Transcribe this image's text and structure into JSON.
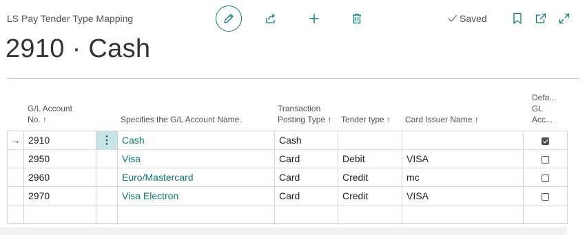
{
  "header": {
    "breadcrumb_title": "LS Pay Tender Type Mapping",
    "saved_status": "Saved",
    "page_title": "2910 · Cash"
  },
  "toolbar": {
    "edit_icon": "pencil-icon",
    "share_icon": "share-icon",
    "new_icon": "plus-icon",
    "delete_icon": "trash-icon"
  },
  "right_icons": [
    "bookmark-icon",
    "open-in-new-window-icon",
    "expand-icon"
  ],
  "table": {
    "columns": {
      "gl_account_no": "G/L Account No. ↑",
      "gl_account_name": "Specifies the G/L Account Name.",
      "transaction_posting_type": "Transaction Posting Type ↑",
      "tender_type": "Tender type ↑",
      "card_issuer_name": "Card Issuer Name ↑",
      "default_gl_account": "Defa... GL Acc..."
    },
    "rows": [
      {
        "gl_account_no": "2910",
        "gl_account_name": "Cash",
        "transaction_posting_type": "Cash",
        "tender_type": "",
        "card_issuer_name": "",
        "default": true,
        "selected": true
      },
      {
        "gl_account_no": "2950",
        "gl_account_name": "Visa",
        "transaction_posting_type": "Card",
        "tender_type": "Debit",
        "card_issuer_name": "VISA",
        "default": false,
        "selected": false
      },
      {
        "gl_account_no": "2960",
        "gl_account_name": "Euro/Mastercard",
        "transaction_posting_type": "Card",
        "tender_type": "Credit",
        "card_issuer_name": "mc",
        "default": false,
        "selected": false
      },
      {
        "gl_account_no": "2970",
        "gl_account_name": "Visa Electron",
        "transaction_posting_type": "Card",
        "tender_type": "Credit",
        "card_issuer_name": "VISA",
        "default": false,
        "selected": false
      }
    ]
  },
  "colors": {
    "accent": "#0b7a75",
    "selected_cell": "#c7e5e6"
  }
}
